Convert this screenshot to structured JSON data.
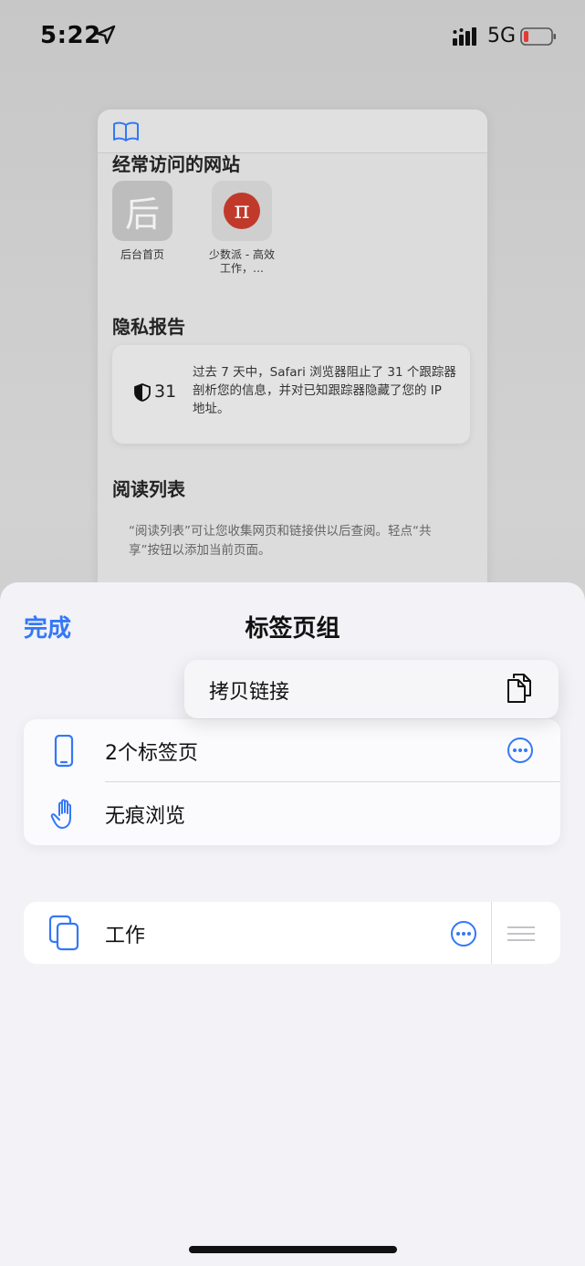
{
  "status_bar": {
    "time": "5:22",
    "network": "5G",
    "icons": [
      "location-arrow-icon",
      "signal-icon",
      "battery-low-icon"
    ]
  },
  "background_page": {
    "frequent_sites_title": "经常访问的网站",
    "frequent_sites": [
      {
        "tile_text": "后",
        "label": "后台首页"
      },
      {
        "tile_text": "π",
        "label": "少数派 - 高效工作，…"
      }
    ],
    "privacy_title": "隐私报告",
    "privacy_count": "31",
    "privacy_text": "过去 7 天中，Safari 浏览器阻止了 31 个跟踪器剖析您的信息，并对已知跟踪器隐藏了您的 IP 地址。",
    "reading_list_title": "阅读列表",
    "reading_list_text": "“阅读列表”可让您收集网页和链接供以后查阅。轻点“共享”按钮以添加当前页面。"
  },
  "sheet": {
    "done_label": "完成",
    "title": "标签页组",
    "context_menu": {
      "copy_link_label": "拷贝链接",
      "icon": "copy-icon"
    },
    "groups": [
      {
        "label": "2个标签页",
        "icon": "iphone-icon",
        "has_more": true
      },
      {
        "label": "无痕浏览",
        "icon": "hand-icon",
        "has_more": false
      }
    ],
    "custom_groups": [
      {
        "label": "工作",
        "icon": "tabs-group-icon",
        "has_more": true
      }
    ]
  },
  "colors": {
    "accent": "#3478f6",
    "sheet_bg": "#f2f2f7"
  }
}
